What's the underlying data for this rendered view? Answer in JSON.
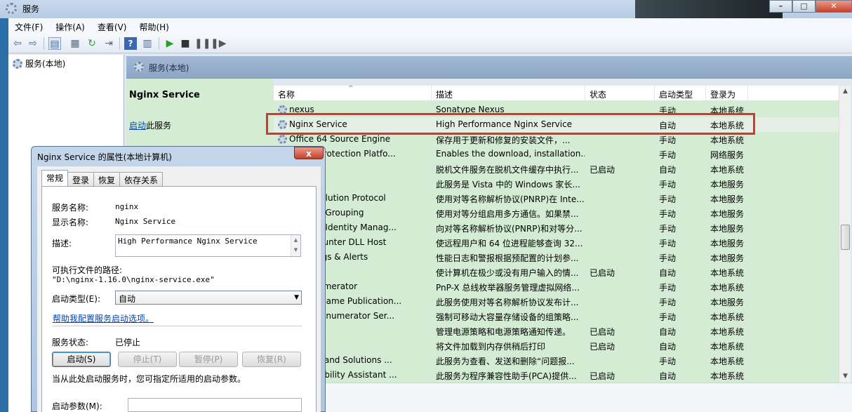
{
  "window": {
    "title": "服务"
  },
  "menu": [
    "文件(F)",
    "操作(A)",
    "查看(V)",
    "帮助(H)"
  ],
  "tree": {
    "root_label": "服务(本地)"
  },
  "right_header": {
    "label": "服务(本地)"
  },
  "extended": {
    "service_title": "Nginx Service",
    "start_link": "启动",
    "start_suffix": "此服务"
  },
  "columns": [
    "名称",
    "描述",
    "状态",
    "启动类型",
    "登录为"
  ],
  "services": [
    {
      "name": "nexus",
      "description": "Sonatype Nexus",
      "status": "",
      "startup": "手动",
      "logon": "本地系统"
    },
    {
      "name": "Nginx Service",
      "description": "High Performance Nginx Service",
      "status": "",
      "startup": "自动",
      "logon": "本地系统"
    },
    {
      "name": "Office 64 Source Engine",
      "description": "保存用于更新和修复的安装文件，...",
      "status": "",
      "startup": "手动",
      "logon": "本地系统"
    },
    {
      "name": "ftware Protection Platfo...",
      "description": "Enables the download, installation...",
      "status": "",
      "startup": "手动",
      "logon": "网络服务"
    },
    {
      "name": "les",
      "description": "脱机文件服务在脱机文件缓存中执行...",
      "status": "已启动",
      "startup": "自动",
      "logon": "本地系统"
    },
    {
      "name": "Controls",
      "description": "此服务是 Vista 中的 Windows 家长...",
      "status": "",
      "startup": "手动",
      "logon": "本地服务"
    },
    {
      "name": "me Resolution Protocol",
      "description": "使用对等名称解析协议(PNRP)在 Inte...",
      "status": "",
      "startup": "手动",
      "logon": "本地服务"
    },
    {
      "name": "working Grouping",
      "description": "使用对等分组启用多方通信。如果禁...",
      "status": "",
      "startup": "手动",
      "logon": "本地服务"
    },
    {
      "name": "working Identity Manag...",
      "description": "向对等名称解析协议(PNRP)和对等分...",
      "status": "",
      "startup": "手动",
      "logon": "本地服务"
    },
    {
      "name": "ance Counter DLL Host",
      "description": "使远程用户和 64 位进程能够查询 32...",
      "status": "",
      "startup": "手动",
      "logon": "本地服务"
    },
    {
      "name": "ance Logs & Alerts",
      "description": "性能日志和警报根据预配置的计划参...",
      "status": "",
      "startup": "手动",
      "logon": "本地服务"
    },
    {
      "name": "Play",
      "description": "使计算机在极少或没有用户输入的情...",
      "status": "已启动",
      "startup": "自动",
      "logon": "本地系统"
    },
    {
      "name": "Bus Enumerator",
      "description": "PnP-X 总线枚举器服务管理虚拟网络...",
      "status": "",
      "startup": "手动",
      "logon": "本地系统"
    },
    {
      "name": "achine Name Publication...",
      "description": "此服务使用对等名称解析协议发布计...",
      "status": "",
      "startup": "手动",
      "logon": "本地服务"
    },
    {
      "name": "Device Enumerator Ser...",
      "description": "强制可移动大容量存储设备的组策略...",
      "status": "",
      "startup": "手动",
      "logon": "本地系统"
    },
    {
      "name": "",
      "description": "管理电源策略和电源策略通知传递。",
      "status": "已启动",
      "startup": "自动",
      "logon": "本地系统"
    },
    {
      "name": "oler",
      "description": "将文件加载到内存供稍后打印",
      "status": "已启动",
      "startup": "自动",
      "logon": "本地系统"
    },
    {
      "name": "Reports and Solutions ...",
      "description": "此服务为查看、发送和删除“问题报...",
      "status": "",
      "startup": "手动",
      "logon": "本地系统"
    },
    {
      "name": "Compatibility Assistant ...",
      "description": "此服务为程序兼容性助手(PCA)提供...",
      "status": "已启动",
      "startup": "自动",
      "logon": "本地系统"
    }
  ],
  "dialog": {
    "title": "Nginx Service 的属性(本地计算机)",
    "close": "x",
    "tabs": [
      "常规",
      "登录",
      "恢复",
      "依存关系"
    ],
    "service_name_label": "服务名称:",
    "service_name_value": "nginx",
    "display_name_label": "显示名称:",
    "display_name_value": "Nginx Service",
    "description_label": "描述:",
    "description_value": "High Performance Nginx Service",
    "path_label": "可执行文件的路径:",
    "path_value": "\"D:\\nginx-1.16.0\\nginx-service.exe\"",
    "startup_type_label": "启动类型(E):",
    "startup_type_value": "自动",
    "help_link": "帮助我配置服务启动选项。",
    "status_label": "服务状态:",
    "status_value": "已停止",
    "buttons": [
      "启动(S)",
      "停止(T)",
      "暂停(P)",
      "恢复(R)"
    ],
    "hint": "当从此处启动服务时，您可指定所适用的启动参数。",
    "param_label": "启动参数(M):"
  }
}
